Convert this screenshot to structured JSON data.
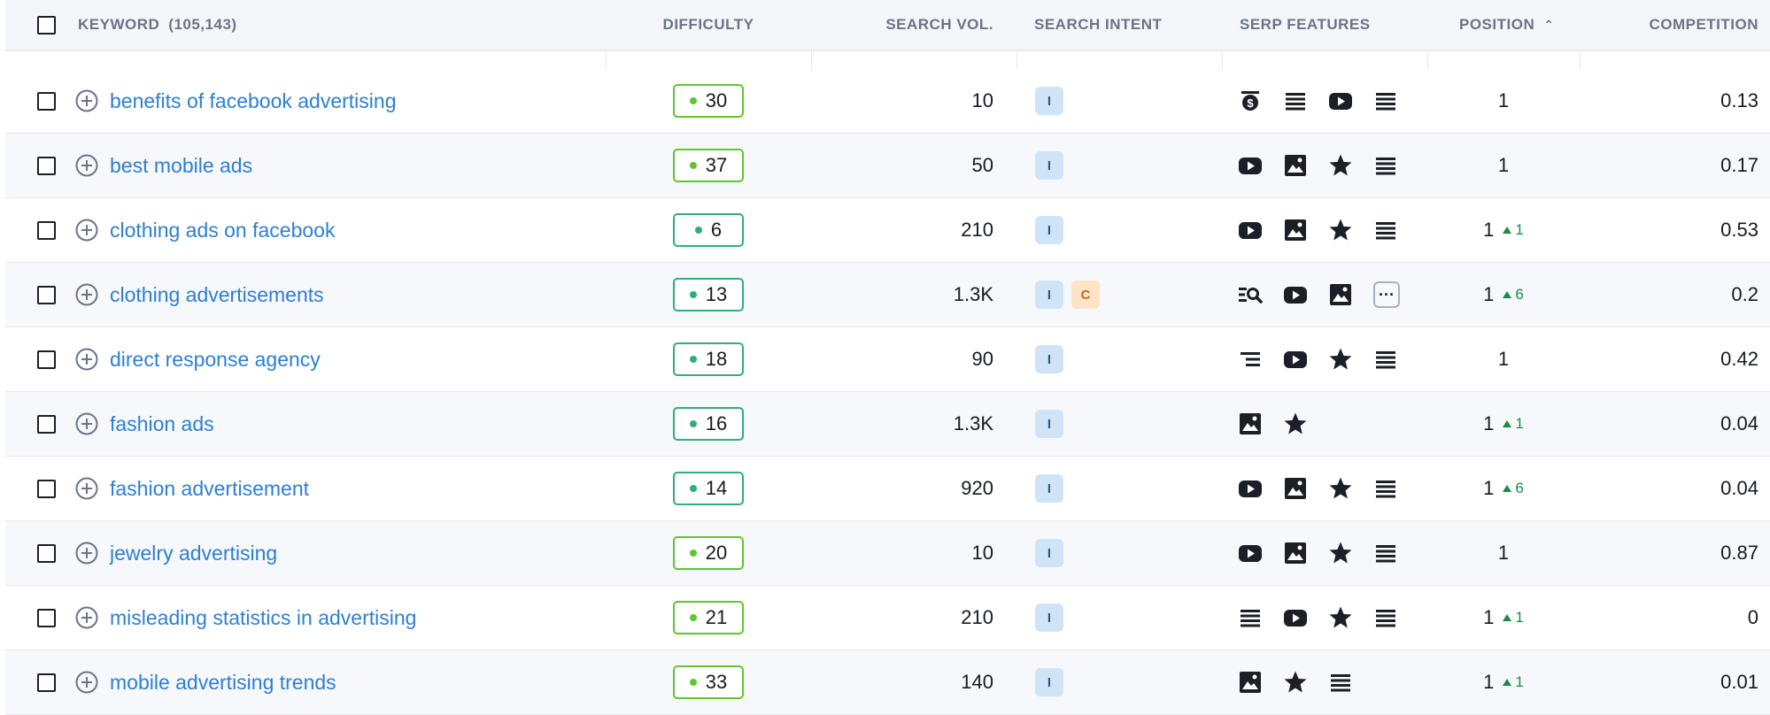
{
  "header": {
    "keyword_label": "KEYWORD",
    "keyword_count": "(105,143)",
    "difficulty": "DIFFICULTY",
    "search_vol": "SEARCH VOL.",
    "search_intent": "SEARCH INTENT",
    "serp_features": "SERP FEATURES",
    "position": "POSITION",
    "position_sort_icon": "chevron-up-icon",
    "competition": "COMPETITION"
  },
  "colors": {
    "keyword_link": "#2d7fd2",
    "kd_green": "#62c42f",
    "kd_teal": "#2fae7a",
    "intent_informational": "#cfe4f7",
    "intent_commercial": "#fce4c4",
    "position_up": "#1a8a47"
  },
  "rows": [
    {
      "keyword": "benefits of facebook advertising",
      "kd": "30",
      "kd_color": "green",
      "volume": "10",
      "intents": [
        "I"
      ],
      "serp": [
        "paid-icon",
        "list-icon",
        "video-icon",
        "list-icon"
      ],
      "position": "1",
      "position_change": "",
      "competition": "0.13"
    },
    {
      "keyword": "best mobile ads",
      "kd": "37",
      "kd_color": "green",
      "volume": "50",
      "intents": [
        "I"
      ],
      "serp": [
        "video-icon",
        "image-icon",
        "star-icon",
        "list-icon"
      ],
      "position": "1",
      "position_change": "",
      "competition": "0.17"
    },
    {
      "keyword": "clothing ads on facebook",
      "kd": "6",
      "kd_color": "teal",
      "volume": "210",
      "intents": [
        "I"
      ],
      "serp": [
        "video-icon",
        "image-icon",
        "star-icon",
        "list-icon"
      ],
      "position": "1",
      "position_change": "1",
      "competition": "0.53"
    },
    {
      "keyword": "clothing advertisements",
      "kd": "13",
      "kd_color": "teal",
      "volume": "1.3K",
      "intents": [
        "I",
        "C"
      ],
      "serp": [
        "search-list-icon",
        "video-icon",
        "image-icon",
        "more-icon"
      ],
      "position": "1",
      "position_change": "6",
      "competition": "0.2"
    },
    {
      "keyword": "direct response agency",
      "kd": "18",
      "kd_color": "teal",
      "volume": "90",
      "intents": [
        "I"
      ],
      "serp": [
        "lines-icon",
        "video-icon",
        "star-icon",
        "list-icon"
      ],
      "position": "1",
      "position_change": "",
      "competition": "0.42"
    },
    {
      "keyword": "fashion ads",
      "kd": "16",
      "kd_color": "teal",
      "volume": "1.3K",
      "intents": [
        "I"
      ],
      "serp": [
        "image-icon",
        "star-icon"
      ],
      "position": "1",
      "position_change": "1",
      "competition": "0.04"
    },
    {
      "keyword": "fashion advertisement",
      "kd": "14",
      "kd_color": "teal",
      "volume": "920",
      "intents": [
        "I"
      ],
      "serp": [
        "video-icon",
        "image-icon",
        "star-icon",
        "list-icon"
      ],
      "position": "1",
      "position_change": "6",
      "competition": "0.04"
    },
    {
      "keyword": "jewelry advertising",
      "kd": "20",
      "kd_color": "green",
      "volume": "10",
      "intents": [
        "I"
      ],
      "serp": [
        "video-icon",
        "image-icon",
        "star-icon",
        "list-icon"
      ],
      "position": "1",
      "position_change": "",
      "competition": "0.87"
    },
    {
      "keyword": "misleading statistics in advertising",
      "kd": "21",
      "kd_color": "green",
      "volume": "210",
      "intents": [
        "I"
      ],
      "serp": [
        "list-icon",
        "video-icon",
        "star-icon",
        "list-icon"
      ],
      "position": "1",
      "position_change": "1",
      "competition": "0"
    },
    {
      "keyword": "mobile advertising trends",
      "kd": "33",
      "kd_color": "green",
      "volume": "140",
      "intents": [
        "I"
      ],
      "serp": [
        "image-icon",
        "star-icon",
        "list-icon"
      ],
      "position": "1",
      "position_change": "1",
      "competition": "0.01"
    }
  ]
}
